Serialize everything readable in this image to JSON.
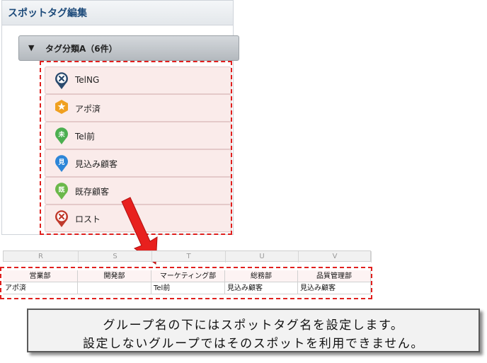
{
  "panel": {
    "title": "スポットタグ編集"
  },
  "group": {
    "arrow": "▼",
    "label": "タグ分類A（6件）"
  },
  "tags": [
    {
      "label": "TelNG",
      "icon": "tel-ng-marker-icon",
      "color": "#2a4a6e",
      "glyph": "✕"
    },
    {
      "label": "アポ済",
      "icon": "appointed-marker-icon",
      "color": "#f0a020",
      "glyph": "★"
    },
    {
      "label": "Tel前",
      "icon": "before-call-marker-icon",
      "color": "#4caf50",
      "glyph": "未"
    },
    {
      "label": "見込み顧客",
      "icon": "prospect-marker-icon",
      "color": "#2d86d8",
      "glyph": "見"
    },
    {
      "label": "既存顧客",
      "icon": "existing-customer-marker-icon",
      "color": "#6bb84a",
      "glyph": "既"
    },
    {
      "label": "ロスト",
      "icon": "lost-marker-icon",
      "color": "#c0392b",
      "glyph": "✕"
    }
  ],
  "sheet": {
    "columns": [
      "R",
      "S",
      "T",
      "U",
      "V"
    ],
    "header_row": [
      "営業部",
      "開発部",
      "マーケティング部",
      "総務部",
      "品質管理部"
    ],
    "data_row": [
      "アポ済",
      "",
      "Tel前",
      "見込み顧客",
      "見込み顧客"
    ]
  },
  "note": {
    "line1": "グループ名の下にはスポットタグ名を設定します。",
    "line2": "設定しないグループではそのスポットを利用できません。"
  },
  "colors": {
    "accent": "#1c4a7a",
    "highlight": "#e0201e"
  }
}
